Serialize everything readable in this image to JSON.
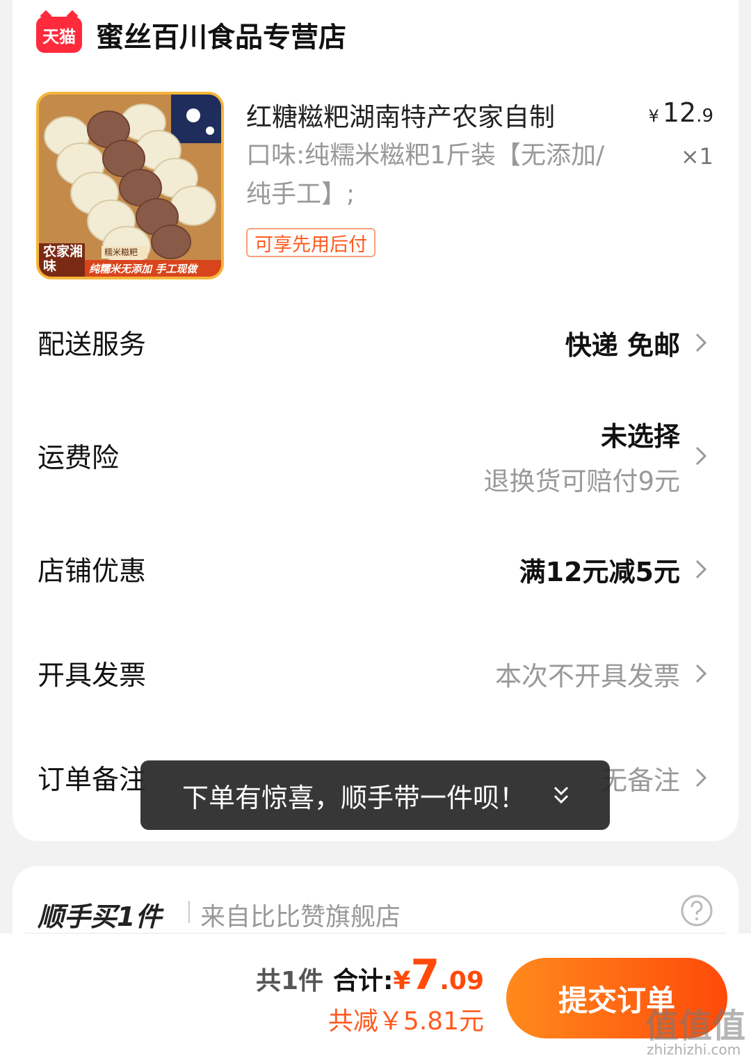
{
  "store": {
    "logo_text": "天猫",
    "name": "蜜丝百川食品专营店"
  },
  "product": {
    "title": "红糖糍粑湖南特产农家自制",
    "spec": "口味:纯糯米糍粑1斤装【无添加/纯手工】;",
    "badge": "可享先用后付",
    "price_currency": "¥",
    "price_int": "12",
    "price_dec": ".9",
    "quantity": "×1",
    "image_texts": {
      "corner": "农家湘味",
      "tag": "糯米糍粑",
      "banner": "纯糯米无添加 手工现做"
    }
  },
  "rows": {
    "delivery": {
      "label": "配送服务",
      "value": "快递 免邮"
    },
    "insurance": {
      "label": "运费险",
      "value": "未选择",
      "sub": "退换货可赔付9元"
    },
    "discount": {
      "label": "店铺优惠",
      "value": "满12元减5元"
    },
    "invoice": {
      "label": "开具发票",
      "value": "本次不开具发票"
    },
    "note": {
      "label": "订单备注",
      "value": "无备注"
    }
  },
  "toast": {
    "text": "下单有惊喜，顺手带一件呗！"
  },
  "addon": {
    "title": "顺手买1件",
    "from": "来自比比赞旗舰店"
  },
  "footer": {
    "count": "共1件",
    "total_label": "合计:",
    "total_currency": "¥",
    "total_int": "7",
    "total_dec": ".09",
    "saving": "共减￥5.81元",
    "submit": "提交订单"
  },
  "watermark": {
    "text": "值值值",
    "url": "zhizhizhi.com"
  },
  "colors": {
    "accent": "#ff4a0a",
    "tmall_red": "#ff2a3c",
    "muted": "#999999"
  }
}
